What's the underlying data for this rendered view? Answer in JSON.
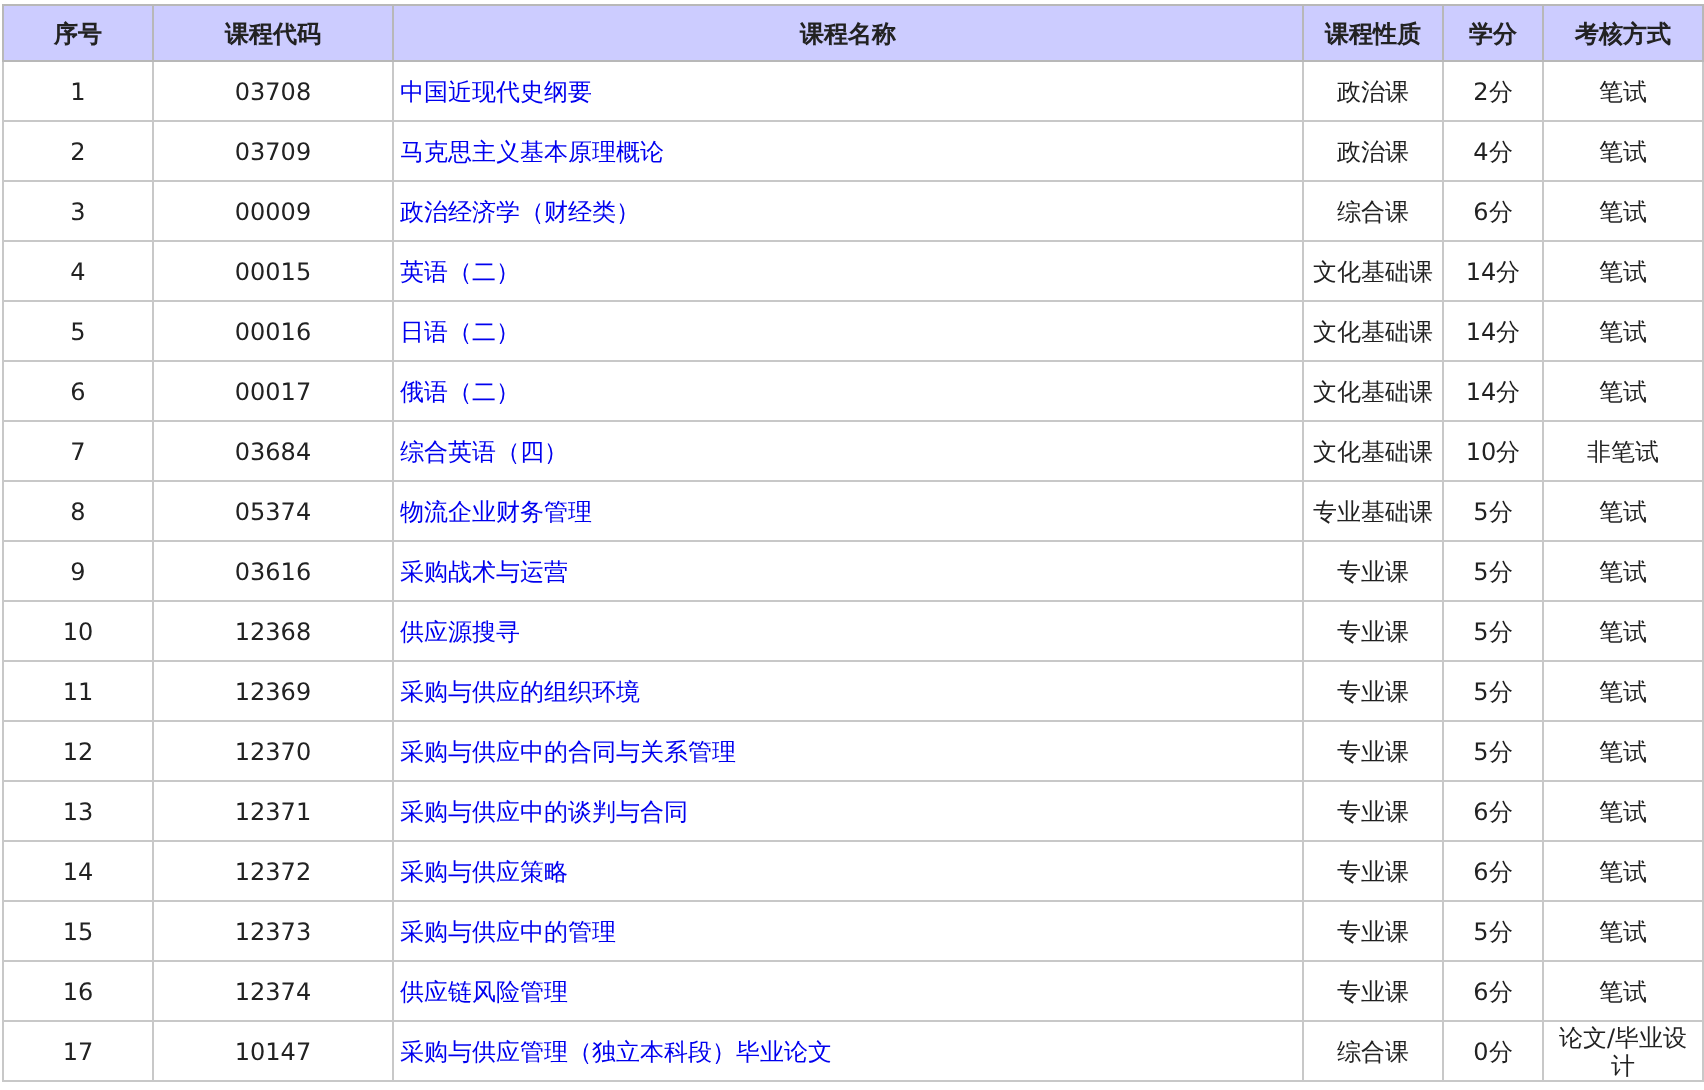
{
  "table": {
    "columns": [
      "序号",
      "课程代码",
      "课程名称",
      "课程性质",
      "学分",
      "考核方式"
    ],
    "rows": [
      [
        "1",
        "03708",
        "中国近现代史纲要",
        "政治课",
        "2分",
        "笔试"
      ],
      [
        "2",
        "03709",
        "马克思主义基本原理概论",
        "政治课",
        "4分",
        "笔试"
      ],
      [
        "3",
        "00009",
        "政治经济学（财经类）",
        "综合课",
        "6分",
        "笔试"
      ],
      [
        "4",
        "00015",
        "英语（二）",
        "文化基础课",
        "14分",
        "笔试"
      ],
      [
        "5",
        "00016",
        "日语（二）",
        "文化基础课",
        "14分",
        "笔试"
      ],
      [
        "6",
        "00017",
        "俄语（二）",
        "文化基础课",
        "14分",
        "笔试"
      ],
      [
        "7",
        "03684",
        "综合英语（四）",
        "文化基础课",
        "10分",
        "非笔试"
      ],
      [
        "8",
        "05374",
        "物流企业财务管理",
        "专业基础课",
        "5分",
        "笔试"
      ],
      [
        "9",
        "03616",
        "采购战术与运营",
        "专业课",
        "5分",
        "笔试"
      ],
      [
        "10",
        "12368",
        "供应源搜寻",
        "专业课",
        "5分",
        "笔试"
      ],
      [
        "11",
        "12369",
        "采购与供应的组织环境",
        "专业课",
        "5分",
        "笔试"
      ],
      [
        "12",
        "12370",
        "采购与供应中的合同与关系管理",
        "专业课",
        "5分",
        "笔试"
      ],
      [
        "13",
        "12371",
        "采购与供应中的谈判与合同",
        "专业课",
        "6分",
        "笔试"
      ],
      [
        "14",
        "12372",
        "采购与供应策略",
        "专业课",
        "6分",
        "笔试"
      ],
      [
        "15",
        "12373",
        "采购与供应中的管理",
        "专业课",
        "5分",
        "笔试"
      ],
      [
        "16",
        "12374",
        "供应链风险管理",
        "专业课",
        "6分",
        "笔试"
      ],
      [
        "17",
        "10147",
        "采购与供应管理（独立本科段）毕业论文",
        "综合课",
        "0分",
        "论文/毕业设计"
      ]
    ]
  }
}
